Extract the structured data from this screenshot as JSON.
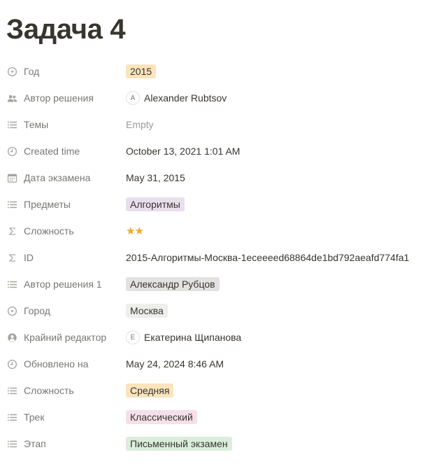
{
  "page": {
    "title": "Задача 4"
  },
  "properties": [
    {
      "name": "Год",
      "icon": "select-icon",
      "type": "tag",
      "value": "2015",
      "color": "#fbe4bc"
    },
    {
      "name": "Автор решения",
      "icon": "people-icon",
      "type": "person",
      "initial": "A",
      "value": "Alexander Rubtsov"
    },
    {
      "name": "Темы",
      "icon": "list-icon",
      "type": "empty",
      "value": "Empty"
    },
    {
      "name": "Created time",
      "icon": "clock-icon",
      "type": "text",
      "value": "October 13, 2021 1:01 AM"
    },
    {
      "name": "Дата экзамена",
      "icon": "calendar-icon",
      "type": "text",
      "value": "May 31, 2015"
    },
    {
      "name": "Предметы",
      "icon": "list-icon",
      "type": "tag",
      "value": "Алгоритмы",
      "color": "#e8deee"
    },
    {
      "name": "Сложность",
      "icon": "formula-icon",
      "type": "stars",
      "value": "★★"
    },
    {
      "name": "ID",
      "icon": "formula-icon",
      "type": "text",
      "value": "2015-Алгоритмы-Москва-1eceeeed68864de1bd792aeafd774fa1"
    },
    {
      "name": "Автор решения 1",
      "icon": "list-icon",
      "type": "tag",
      "value": "Александр Рубцов",
      "color": "#e3e2e0"
    },
    {
      "name": "Город",
      "icon": "select-icon",
      "type": "tag",
      "value": "Москва",
      "color": "#eeeeec"
    },
    {
      "name": "Крайний редактор",
      "icon": "person-icon",
      "type": "person",
      "initial": "E",
      "value": "Екатерина Щипанова"
    },
    {
      "name": "Обновлено на",
      "icon": "clock-icon",
      "type": "text",
      "value": "May 24, 2024 8:46 AM"
    },
    {
      "name": "Сложность",
      "icon": "list-icon",
      "type": "tag",
      "value": "Средняя",
      "color": "#fbe4bc"
    },
    {
      "name": "Трек",
      "icon": "list-icon",
      "type": "tag",
      "value": "Классический",
      "color": "#f5e0e9"
    },
    {
      "name": "Этап",
      "icon": "list-icon",
      "type": "tag",
      "value": "Письменный экзамен",
      "color": "#dbeddb"
    }
  ]
}
